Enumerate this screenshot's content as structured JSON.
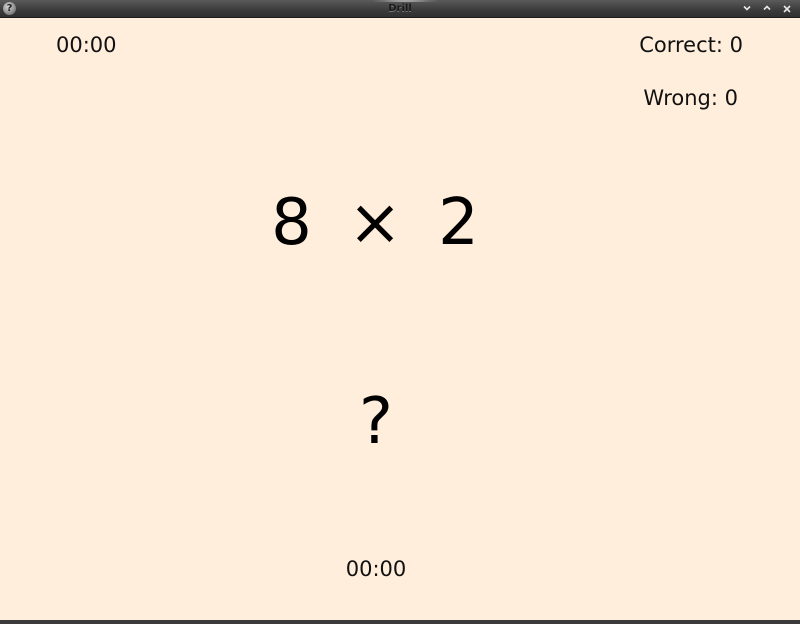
{
  "window": {
    "title": "Drill",
    "help_glyph": "?",
    "controls": {
      "minimize_icon": "chevron-down-icon",
      "maximize_icon": "chevron-up-icon",
      "close_icon": "close-icon"
    },
    "background_color": "#ffeedb"
  },
  "stats": {
    "elapsed_time": "00:00",
    "correct_label": "Correct: 0",
    "wrong_label": "Wrong: 0"
  },
  "problem": {
    "expression": "8 × 2",
    "answer_placeholder": "?"
  },
  "footer": {
    "question_timer": "00:00"
  }
}
